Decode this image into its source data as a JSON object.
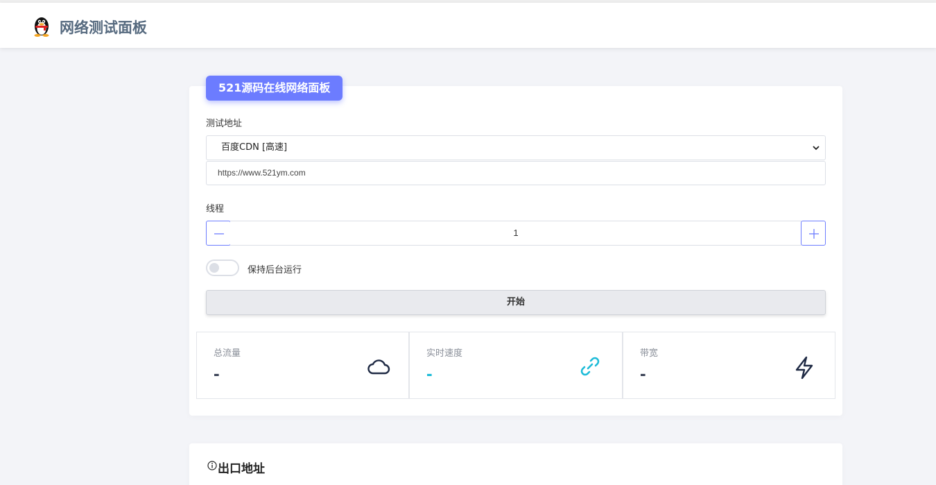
{
  "header": {
    "title": "网络测试面板",
    "logo_icon": "qq-penguin-icon"
  },
  "panel": {
    "badge": "521源码在线网络面板",
    "url_label": "测试地址",
    "node_select": "百度CDN [高速]",
    "url_value": "https://www.521ym.com",
    "threads_label": "线程",
    "threads_value": "1",
    "background_toggle_label": "保持后台运行",
    "background_toggle_on": false,
    "start_button": "开始"
  },
  "stats": [
    {
      "title": "总流量",
      "value": "-",
      "icon": "cloud-icon",
      "color": "#3a4256"
    },
    {
      "title": "实时速度",
      "value": "-",
      "icon": "link-icon",
      "color": "#1cbbd8"
    },
    {
      "title": "带宽",
      "value": "-",
      "icon": "lightning-icon",
      "color": "#3a4256"
    }
  ],
  "exit_section": {
    "title": "出口地址",
    "icon": "info-circle-icon"
  },
  "colors": {
    "accent": "#6c7cff",
    "cyan": "#1cbbd8",
    "background": "#f3f4f8"
  }
}
